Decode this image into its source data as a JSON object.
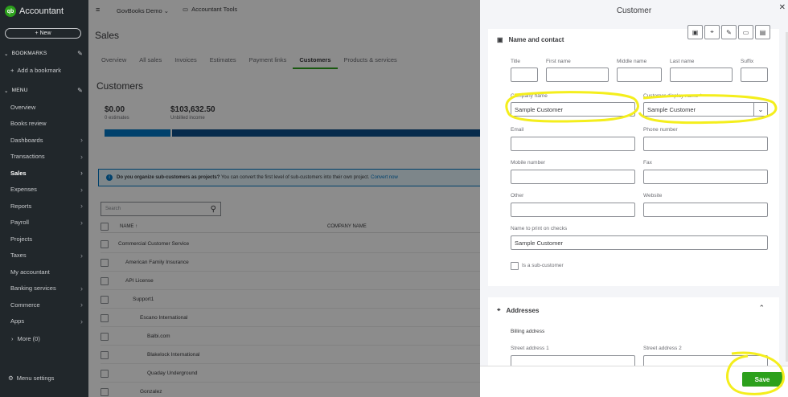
{
  "nav": {
    "app_name": "Accountant",
    "logo_mark": "qb",
    "new_label": "+ New",
    "bookmarks_label": "BOOKMARKS",
    "add_bookmark_label": "Add a bookmark",
    "menu_label": "MENU",
    "items": [
      {
        "label": "Overview",
        "chevron": false
      },
      {
        "label": "Books review",
        "chevron": false
      },
      {
        "label": "Dashboards",
        "chevron": true
      },
      {
        "label": "Transactions",
        "chevron": true
      },
      {
        "label": "Sales",
        "chevron": true,
        "active": true
      },
      {
        "label": "Expenses",
        "chevron": true
      },
      {
        "label": "Reports",
        "chevron": true
      },
      {
        "label": "Payroll",
        "chevron": true
      },
      {
        "label": "Projects",
        "chevron": false
      },
      {
        "label": "Taxes",
        "chevron": true
      },
      {
        "label": "My accountant",
        "chevron": false
      },
      {
        "label": "Banking services",
        "chevron": true
      },
      {
        "label": "Commerce",
        "chevron": true
      },
      {
        "label": "Apps",
        "chevron": true
      }
    ],
    "more_label": "More (0)",
    "menu_settings_label": "Menu settings"
  },
  "topbar": {
    "company": "GovBooks Demo",
    "tools": "Accountant Tools"
  },
  "page": {
    "title": "Sales",
    "tabs": [
      "Overview",
      "All sales",
      "Invoices",
      "Estimates",
      "Payment links",
      "Customers",
      "Products & services"
    ],
    "active_tab": "Customers",
    "subtitle": "Customers",
    "estimates_amount": "$0.00",
    "estimates_caption": "0 estimates",
    "unbilled_amount": "$103,632.50",
    "unbilled_caption": "Unbilled income"
  },
  "banner": {
    "bold": "Do you organize sub-customers as projects?",
    "text": "You can convert the first level of sub-customers into their own project.",
    "link": "Convert now"
  },
  "table": {
    "search_placeholder": "Search",
    "col_name": "NAME ↑",
    "col_company": "COMPANY NAME",
    "rows": [
      {
        "name": "Commercial Customer Service",
        "indent": 0
      },
      {
        "name": "American Family Insurance",
        "indent": 1
      },
      {
        "name": "API License",
        "indent": 1
      },
      {
        "name": "Support1",
        "indent": 2
      },
      {
        "name": "Escano International",
        "indent": 3
      },
      {
        "name": "Balbi.com",
        "indent": 4
      },
      {
        "name": "Blakelock International",
        "indent": 4
      },
      {
        "name": "Quaday Underground",
        "indent": 4
      },
      {
        "name": "Gonzalez",
        "indent": 3
      }
    ]
  },
  "panel": {
    "title": "Customer",
    "close_icon": "close-icon",
    "tool_icons": [
      "contact-card-icon",
      "location-pin-icon",
      "edit-note-icon",
      "payment-card-icon",
      "document-icon"
    ],
    "name_section": {
      "title": "Name and contact",
      "title_label": "Title",
      "first_label": "First name",
      "middle_label": "Middle name",
      "last_label": "Last name",
      "suffix_label": "Suffix",
      "company_label": "Company name",
      "company_value": "Sample Customer",
      "display_label": "Customer display name *",
      "display_value": "Sample Customer",
      "email_label": "Email",
      "phone_label": "Phone number",
      "mobile_label": "Mobile number",
      "fax_label": "Fax",
      "other_label": "Other",
      "website_label": "Website",
      "checks_label": "Name to print on checks",
      "checks_value": "Sample Customer",
      "subcustomer_label": "Is a sub-customer"
    },
    "address_section": {
      "title": "Addresses",
      "billing_label": "Billing address",
      "street1_label": "Street address 1",
      "street2_label": "Street address 2"
    },
    "save_label": "Save"
  },
  "colors": {
    "brand_green": "#2ca01c",
    "nav_bg": "#21272b",
    "annotation_yellow": "#f4ee1c",
    "link_blue": "#0077c5"
  }
}
